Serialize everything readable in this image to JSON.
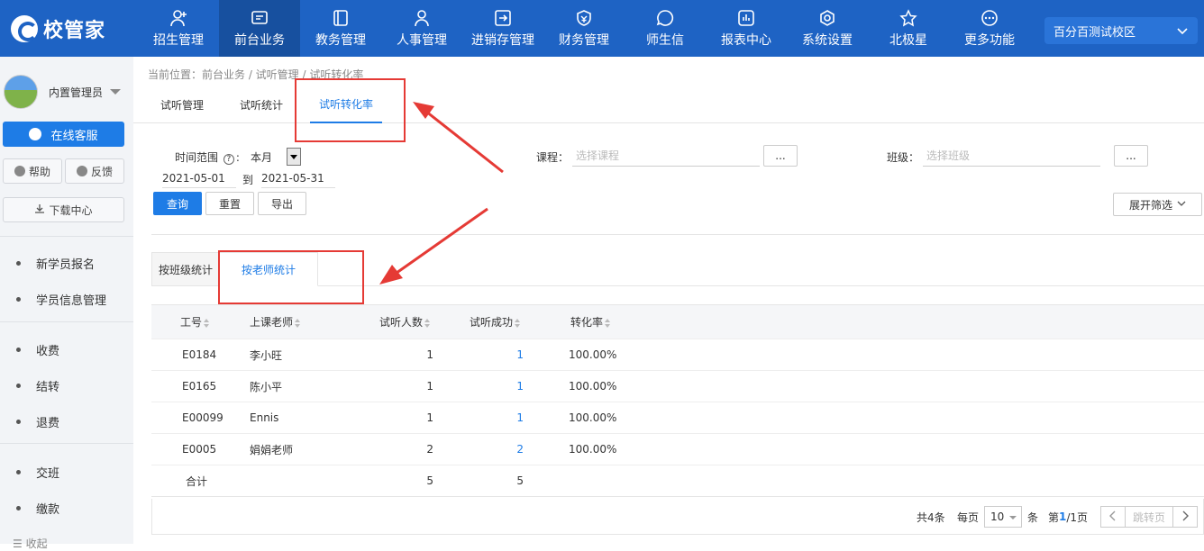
{
  "logo": {
    "name": "校管家"
  },
  "nav": [
    {
      "label": "招生管理",
      "icon": "person-add-icon"
    },
    {
      "label": "前台业务",
      "icon": "monitor-icon"
    },
    {
      "label": "教务管理",
      "icon": "book-icon"
    },
    {
      "label": "人事管理",
      "icon": "person-icon"
    },
    {
      "label": "进销存管理",
      "icon": "exchange-icon"
    },
    {
      "label": "财务管理",
      "icon": "money-shield-icon"
    },
    {
      "label": "师生信",
      "icon": "chat-icon"
    },
    {
      "label": "报表中心",
      "icon": "chart-icon"
    },
    {
      "label": "系统设置",
      "icon": "gear-icon"
    },
    {
      "label": "北极星",
      "icon": "star-icon"
    },
    {
      "label": "更多功能",
      "icon": "more-icon"
    }
  ],
  "campus": "百分百测试校区",
  "sidebar": {
    "user": "内置管理员",
    "service": "在线客服",
    "help": "帮助",
    "feedback": "反馈",
    "download": "下载中心",
    "group1": [
      "新学员报名",
      "学员信息管理"
    ],
    "group2": [
      "收费",
      "结转",
      "退费"
    ],
    "group3": [
      "交班",
      "缴款"
    ],
    "collapse": "收起"
  },
  "breadcrumb": "当前位置：前台业务 / 试听管理 / 试听转化率",
  "tabs": [
    "试听管理",
    "试听统计",
    "试听转化率"
  ],
  "filters": {
    "time_label": "时间范围",
    "time_value": "本月",
    "date_from": "2021-05-01",
    "to_label": "到",
    "date_to": "2021-05-31",
    "course_label": "课程：",
    "course_placeholder": "选择课程",
    "class_label": "班级：",
    "class_placeholder": "选择班级",
    "dots": "...",
    "query": "查询",
    "reset": "重置",
    "export": "导出",
    "expand": "展开筛选"
  },
  "subtabs": [
    "按班级统计",
    "按老师统计"
  ],
  "table": {
    "headers": [
      "工号",
      "上课老师",
      "试听人数",
      "试听成功",
      "转化率"
    ],
    "rows": [
      {
        "id": "E0184",
        "teacher": "李小旺",
        "count": "1",
        "success": "1",
        "rate": "100.00%"
      },
      {
        "id": "E0165",
        "teacher": "陈小平",
        "count": "1",
        "success": "1",
        "rate": "100.00%"
      },
      {
        "id": "E00099",
        "teacher": "Ennis",
        "count": "1",
        "success": "1",
        "rate": "100.00%"
      },
      {
        "id": "E0005",
        "teacher": "娟娟老师",
        "count": "2",
        "success": "2",
        "rate": "100.00%"
      }
    ],
    "total": {
      "label": "合计",
      "count": "5",
      "success": "5"
    }
  },
  "pager": {
    "total": "共4条",
    "per_page_label": "每页",
    "per_page": "10",
    "unit": "条",
    "page_prefix": "第",
    "page_current": "1",
    "page_rest": "/1页",
    "jump": "跳转页"
  }
}
